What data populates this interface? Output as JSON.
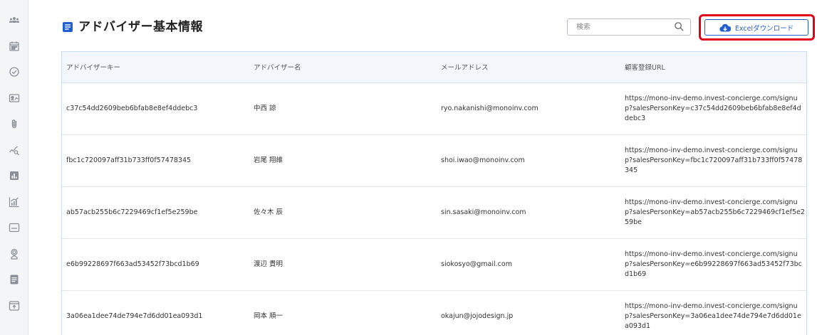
{
  "sidebar": {
    "items": [
      {
        "icon": "users-icon"
      },
      {
        "icon": "calendar-icon"
      },
      {
        "icon": "check-circle-icon"
      },
      {
        "icon": "id-card-icon"
      },
      {
        "icon": "paperclip-icon"
      },
      {
        "icon": "trend-search-icon"
      },
      {
        "icon": "bar-chart-icon"
      },
      {
        "icon": "analytics-chart-icon"
      },
      {
        "icon": "window-icon"
      },
      {
        "icon": "advisor-icon"
      },
      {
        "icon": "document-icon"
      },
      {
        "icon": "upload-box-icon"
      }
    ]
  },
  "header": {
    "title": "アドバイザー基本情報",
    "search_placeholder": "検索",
    "download_label": "Excelダウンロード"
  },
  "colors": {
    "accent": "#1f5fcf",
    "highlight": "#e0001a",
    "header_bg": "#f3f7fc"
  },
  "table": {
    "columns": [
      "アドバイザーキー",
      "アドバイザー名",
      "メールアドレス",
      "顧客登録URL"
    ],
    "rows": [
      {
        "key": "c37c54dd2609beb6bfab8e8ef4ddebc3",
        "name": "中西 諒",
        "email": "ryo.nakanishi@monoinv.com",
        "url": "https://mono-inv-demo.invest-concierge.com/signup?salesPersonKey=c37c54dd2609beb6bfab8e8ef4ddebc3"
      },
      {
        "key": "fbc1c720097aff31b733ff0f57478345",
        "name": "岩尾 翔維",
        "email": "shoi.iwao@monoinv.com",
        "url": "https://mono-inv-demo.invest-concierge.com/signup?salesPersonKey=fbc1c720097aff31b733ff0f57478345"
      },
      {
        "key": "ab57acb255b6c7229469cf1ef5e259be",
        "name": "佐々木 辰",
        "email": "sin.sasaki@monoinv.com",
        "url": "https://mono-inv-demo.invest-concierge.com/signup?salesPersonKey=ab57acb255b6c7229469cf1ef5e259be"
      },
      {
        "key": "e6b99228697f663ad53452f73bcd1b69",
        "name": "渡辺 貴明",
        "email": "siokosyo@gmail.com",
        "url": "https://mono-inv-demo.invest-concierge.com/signup?salesPersonKey=e6b99228697f663ad53452f73bcd1b69"
      },
      {
        "key": "3a06ea1dee74de794e7d6dd01ea093d1",
        "name": "岡本 順一",
        "email": "okajun@jojodesign.jp",
        "url": "https://mono-inv-demo.invest-concierge.com/signup?salesPersonKey=3a06ea1dee74de794e7d6dd01ea093d1"
      }
    ]
  }
}
